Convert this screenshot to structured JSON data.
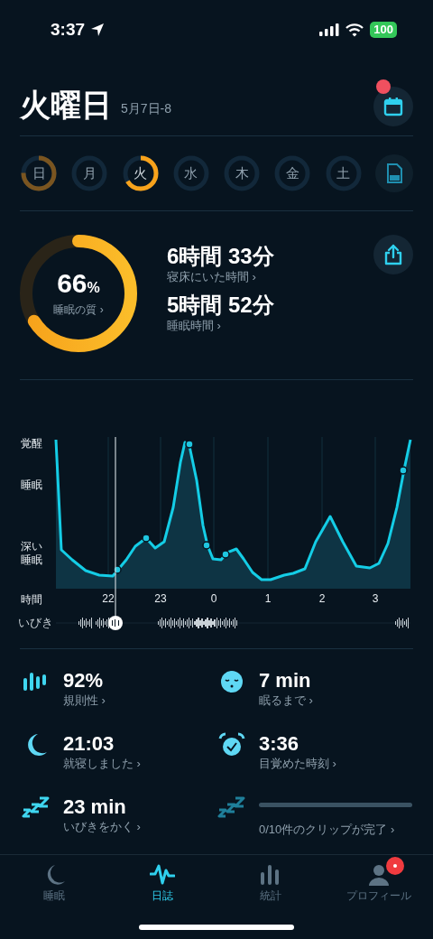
{
  "status_bar": {
    "time": "3:37",
    "battery": "100"
  },
  "header": {
    "title": "火曜日",
    "date": "5月7日-8",
    "calendar_badge": true
  },
  "days": [
    {
      "kind": "day",
      "label": "日",
      "recorded": true,
      "selected": false
    },
    {
      "kind": "day",
      "label": "月",
      "recorded": false,
      "selected": false
    },
    {
      "kind": "day",
      "label": "火",
      "recorded": true,
      "selected": true
    },
    {
      "kind": "day",
      "label": "水",
      "recorded": false,
      "selected": false
    },
    {
      "kind": "day",
      "label": "木",
      "recorded": false,
      "selected": false
    },
    {
      "kind": "day",
      "label": "金",
      "recorded": false,
      "selected": false
    },
    {
      "kind": "day",
      "label": "土",
      "recorded": false,
      "selected": false
    },
    {
      "kind": "report"
    }
  ],
  "quality": {
    "value": "66",
    "unit": "%",
    "label": "睡眠の質 ›"
  },
  "durations": [
    {
      "value": "6時間 33分",
      "label": "寝床にいた時間 ›"
    },
    {
      "value": "5時間 52分",
      "label": "睡眠時間 ›"
    }
  ],
  "hypnogram": {
    "y_labels": [
      "覚醒",
      "睡眠",
      "深い睡眠"
    ],
    "x_title": "時間",
    "x_labels": [
      "22",
      "23",
      "0",
      "1",
      "2",
      "3"
    ],
    "snore_label": "いびき"
  },
  "stats": [
    {
      "kind": "stat",
      "value": "92%",
      "label": "規則性 ›"
    },
    {
      "kind": "stat",
      "value": "7 min",
      "label": "眠るまで ›"
    },
    {
      "kind": "stat",
      "value": "21:03",
      "label": "就寝しました ›"
    },
    {
      "kind": "stat",
      "value": "3:36",
      "label": "目覚めた時刻 ›"
    },
    {
      "kind": "stat",
      "value": "23 min",
      "label": "いびきをかく ›"
    },
    {
      "kind": "progress",
      "level": 0,
      "label": "0/10件のクリップが完了 ›"
    }
  ],
  "tabs": [
    {
      "label": "睡眠",
      "selected": false,
      "badge": false
    },
    {
      "label": "日誌",
      "selected": true,
      "badge": false
    },
    {
      "label": "統計",
      "selected": false,
      "badge": false
    },
    {
      "label": "プロフィール",
      "selected": false,
      "badge": true
    }
  ]
}
